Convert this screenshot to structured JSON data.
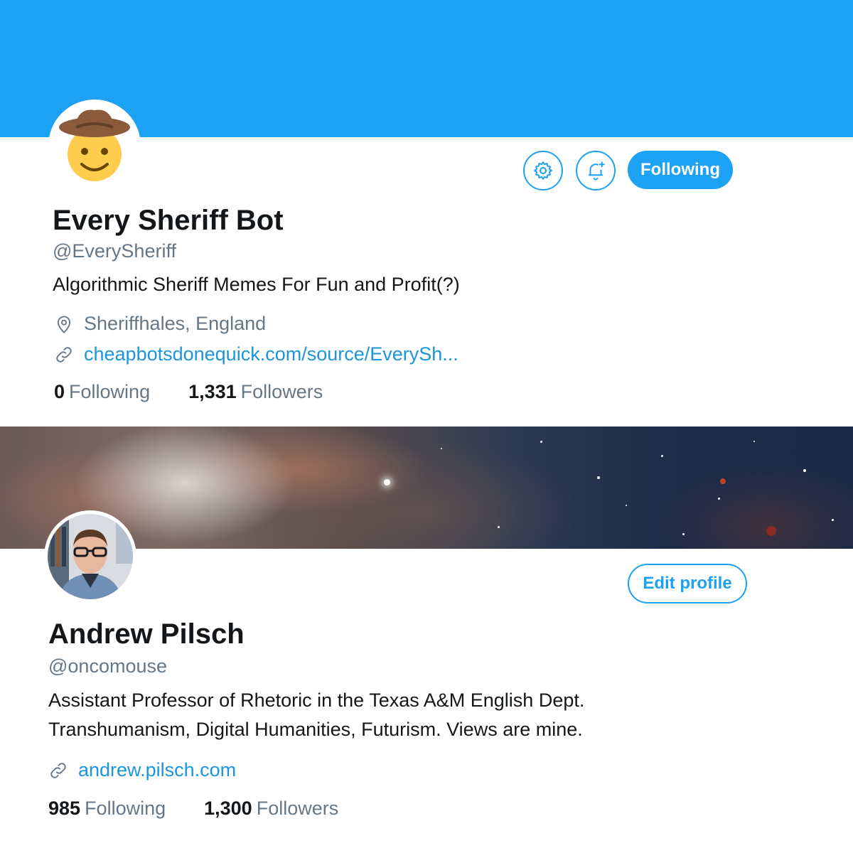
{
  "profiles": [
    {
      "name": "Every Sheriff Bot",
      "handle": "@EverySheriff",
      "bio": "Algorithmic Sheriff Memes For Fun and Profit(?)",
      "location": "Sheriffhales, England",
      "link": "cheapbotsdonequick.com/source/EverySh...",
      "following_count": "0",
      "following_label": "Following",
      "followers_count": "1,331",
      "followers_label": "Followers",
      "follow_button_label": "Following",
      "avatar_icon": "cowboy-face-emoji",
      "banner_color": "#1da1f2"
    },
    {
      "name": "Andrew Pilsch",
      "handle": "@oncomouse",
      "bio_line1": "Assistant Professor of Rhetoric in the Texas A&M English Dept.",
      "bio_line2": "Transhumanism, Digital Humanities, Futurism. Views are mine.",
      "link": "andrew.pilsch.com",
      "following_count": "985",
      "following_label": "Following",
      "followers_count": "1,300",
      "followers_label": "Followers",
      "edit_button_label": "Edit profile",
      "avatar_icon": "user-photo",
      "banner_image": "space-nebula"
    }
  ],
  "colors": {
    "accent": "#1da1f2",
    "link": "#1b95e0",
    "secondary_text": "#657786",
    "primary_text": "#14171a"
  }
}
